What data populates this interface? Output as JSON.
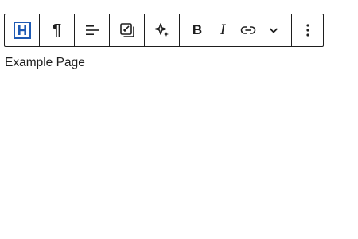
{
  "toolbar": {
    "buttons": [
      {
        "icon": "heading-icon",
        "label": "H",
        "accent": "#1e5ab4"
      },
      {
        "icon": "paragraph-icon",
        "label": "¶"
      },
      {
        "icon": "align-left-icon"
      },
      {
        "icon": "block-style-icon"
      },
      {
        "icon": "sparkle-icon"
      },
      {
        "icon": "bold-icon",
        "label": "B"
      },
      {
        "icon": "italic-icon",
        "label": "I"
      },
      {
        "icon": "link-icon"
      },
      {
        "icon": "chevron-down-icon"
      },
      {
        "icon": "more-options-icon"
      }
    ]
  },
  "content": {
    "text": "Example Page"
  }
}
